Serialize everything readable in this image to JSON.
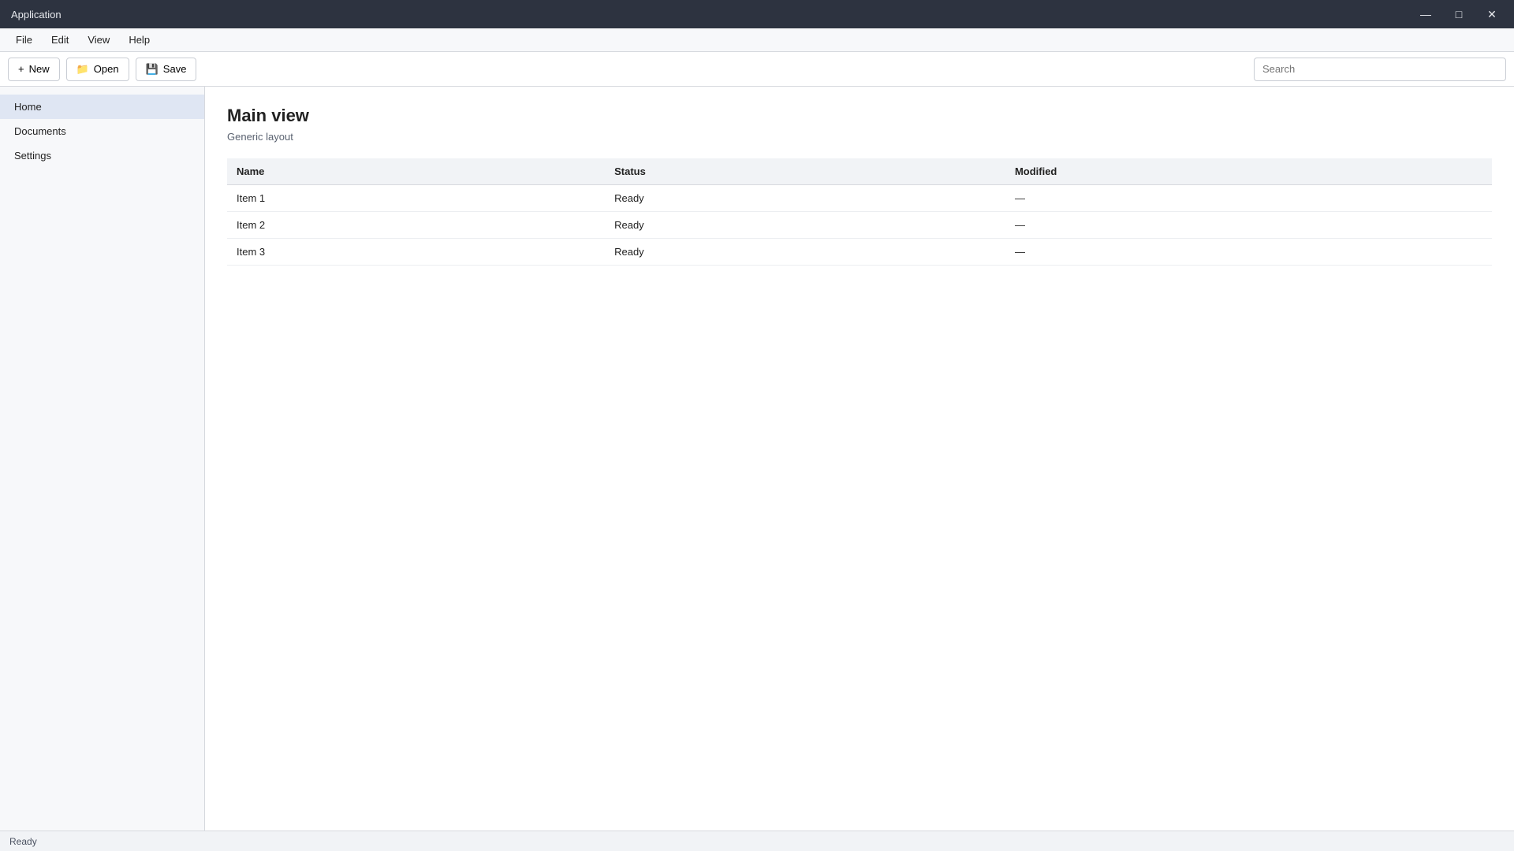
{
  "app": {
    "title": "Application"
  },
  "menu": [
    "File",
    "Edit",
    "View",
    "Help"
  ],
  "toolbar": {
    "new_label": "New",
    "open_label": "Open",
    "save_label": "Save",
    "search_placeholder": "Search"
  },
  "sidebar": {
    "items": [
      {
        "label": "Home"
      },
      {
        "label": "Documents"
      },
      {
        "label": "Settings"
      }
    ]
  },
  "main": {
    "title": "Main view",
    "subtitle": "Generic layout",
    "columns": [
      "Name",
      "Status",
      "Modified"
    ],
    "rows": [
      [
        "Item 1",
        "Ready",
        "—"
      ],
      [
        "Item 2",
        "Ready",
        "—"
      ],
      [
        "Item 3",
        "Ready",
        "—"
      ]
    ]
  },
  "status": {
    "text": "Ready"
  }
}
